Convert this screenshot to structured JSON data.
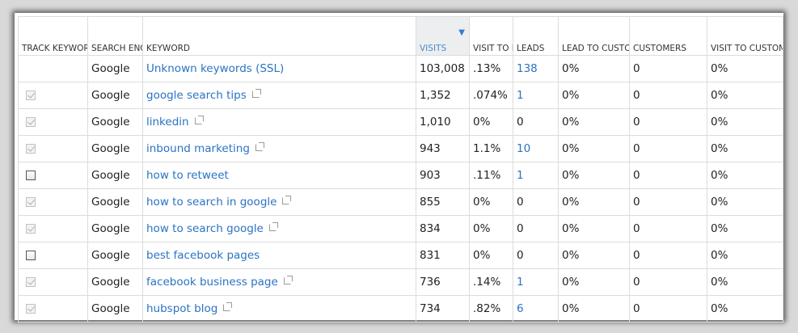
{
  "table": {
    "headers": [
      {
        "key": "track",
        "label": "TRACK KEYWORDS?"
      },
      {
        "key": "engine",
        "label": "SEARCH ENGINE"
      },
      {
        "key": "keyword",
        "label": "KEYWORD"
      },
      {
        "key": "visits",
        "label": "VISITS",
        "sorted": "desc"
      },
      {
        "key": "visit_to_lead",
        "label": "VISIT TO LEAD"
      },
      {
        "key": "leads",
        "label": "LEADS"
      },
      {
        "key": "lead_to_customer",
        "label": "LEAD TO CUSTOMER"
      },
      {
        "key": "customers",
        "label": "CUSTOMERS"
      },
      {
        "key": "visit_to_customer",
        "label": "VISIT TO CUSTOMER"
      }
    ],
    "sort_icon": "sort-down-triangle-icon",
    "rows": [
      {
        "track": "none",
        "engine": "Google",
        "keyword": "Unknown keywords (SSL)",
        "external": false,
        "visits": "103,008",
        "visit_to_lead": ".13%",
        "leads": "138",
        "leads_link": true,
        "lead_to_customer": "0%",
        "customers": "0",
        "visit_to_customer": "0%"
      },
      {
        "track": "checked",
        "engine": "Google",
        "keyword": "google search tips",
        "external": true,
        "visits": "1,352",
        "visit_to_lead": ".074%",
        "leads": "1",
        "leads_link": true,
        "lead_to_customer": "0%",
        "customers": "0",
        "visit_to_customer": "0%"
      },
      {
        "track": "checked",
        "engine": "Google",
        "keyword": "linkedin",
        "external": true,
        "visits": "1,010",
        "visit_to_lead": "0%",
        "leads": "0",
        "leads_link": false,
        "lead_to_customer": "0%",
        "customers": "0",
        "visit_to_customer": "0%"
      },
      {
        "track": "checked",
        "engine": "Google",
        "keyword": "inbound marketing",
        "external": true,
        "visits": "943",
        "visit_to_lead": "1.1%",
        "leads": "10",
        "leads_link": true,
        "lead_to_customer": "0%",
        "customers": "0",
        "visit_to_customer": "0%"
      },
      {
        "track": "unchecked",
        "engine": "Google",
        "keyword": "how to retweet",
        "external": false,
        "visits": "903",
        "visit_to_lead": ".11%",
        "leads": "1",
        "leads_link": true,
        "lead_to_customer": "0%",
        "customers": "0",
        "visit_to_customer": "0%"
      },
      {
        "track": "checked",
        "engine": "Google",
        "keyword": "how to search in google",
        "external": true,
        "visits": "855",
        "visit_to_lead": "0%",
        "leads": "0",
        "leads_link": false,
        "lead_to_customer": "0%",
        "customers": "0",
        "visit_to_customer": "0%"
      },
      {
        "track": "checked",
        "engine": "Google",
        "keyword": "how to search google",
        "external": true,
        "visits": "834",
        "visit_to_lead": "0%",
        "leads": "0",
        "leads_link": false,
        "lead_to_customer": "0%",
        "customers": "0",
        "visit_to_customer": "0%"
      },
      {
        "track": "unchecked",
        "engine": "Google",
        "keyword": "best facebook pages",
        "external": false,
        "visits": "831",
        "visit_to_lead": "0%",
        "leads": "0",
        "leads_link": false,
        "lead_to_customer": "0%",
        "customers": "0",
        "visit_to_customer": "0%"
      },
      {
        "track": "checked",
        "engine": "Google",
        "keyword": "facebook business page",
        "external": true,
        "visits": "736",
        "visit_to_lead": ".14%",
        "leads": "1",
        "leads_link": true,
        "lead_to_customer": "0%",
        "customers": "0",
        "visit_to_customer": "0%"
      },
      {
        "track": "checked",
        "engine": "Google",
        "keyword": "hubspot blog",
        "external": true,
        "visits": "734",
        "visit_to_lead": ".82%",
        "leads": "6",
        "leads_link": true,
        "lead_to_customer": "0%",
        "customers": "0",
        "visit_to_customer": "0%"
      }
    ]
  }
}
